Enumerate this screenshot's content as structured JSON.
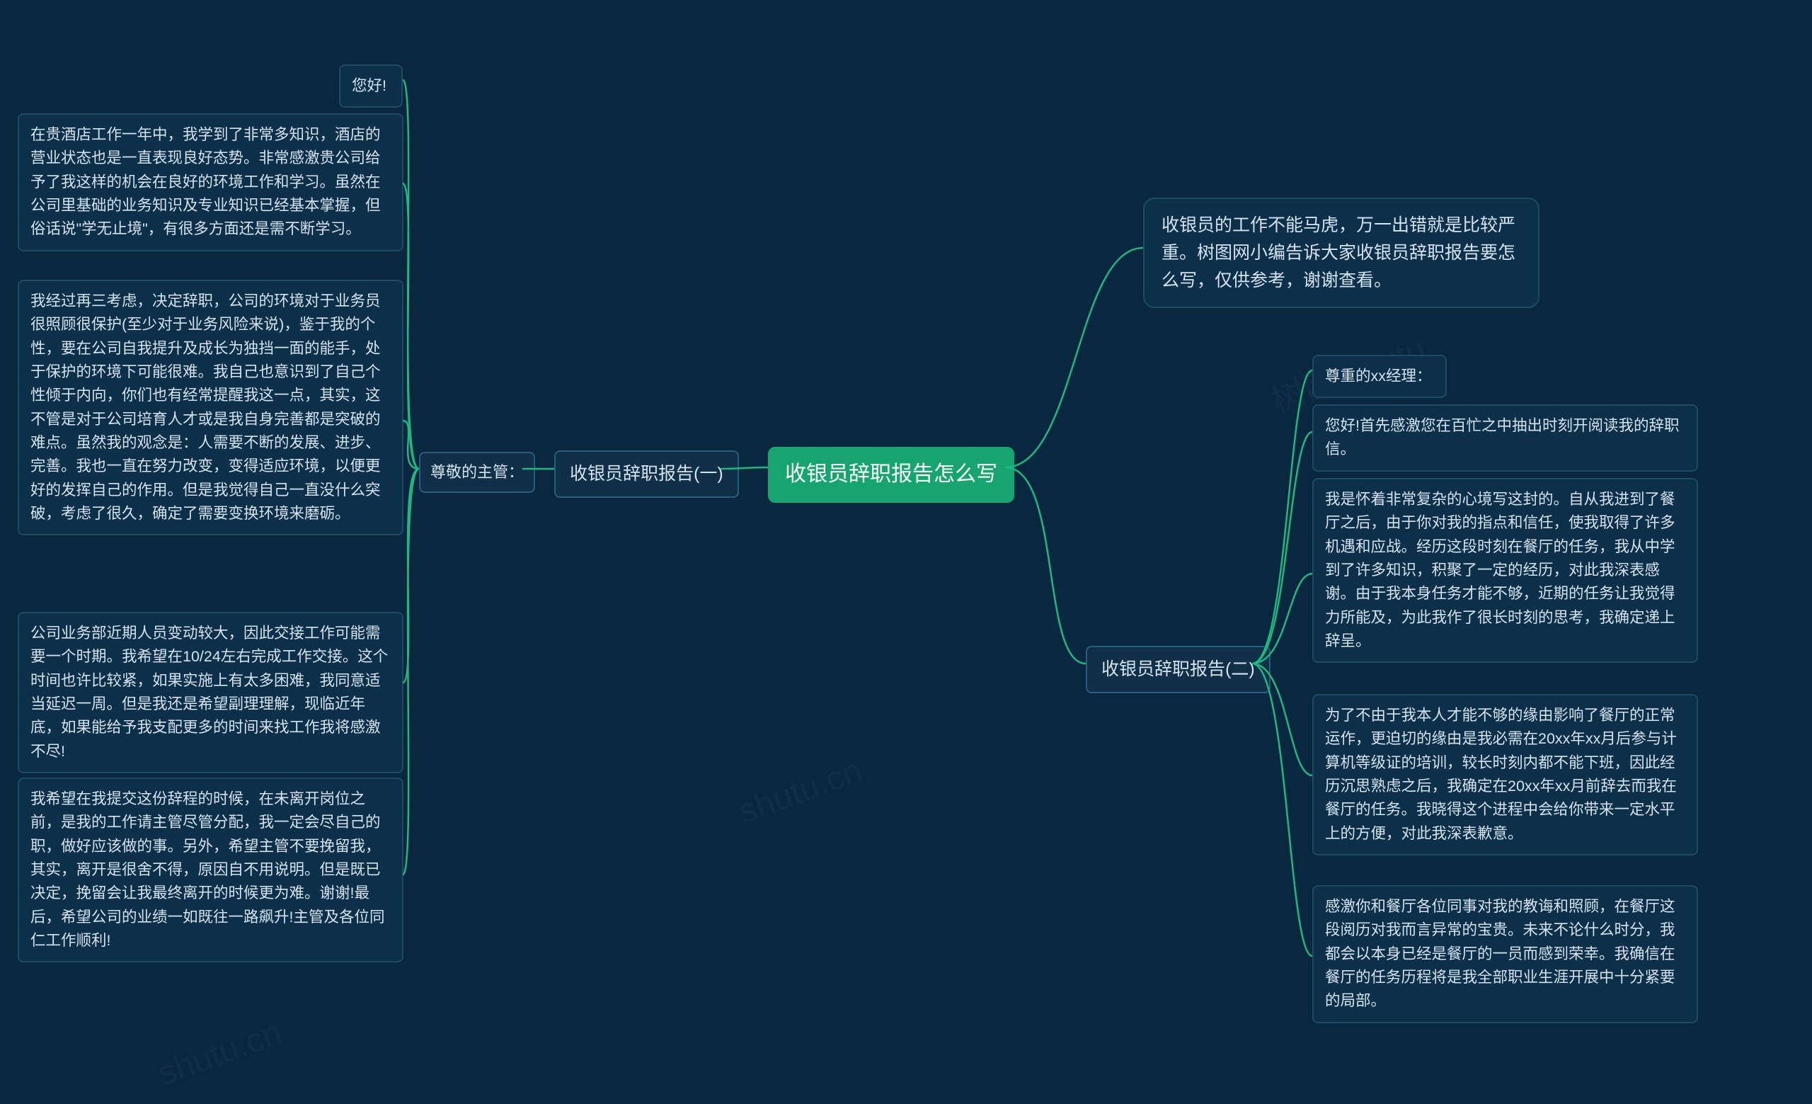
{
  "watermarks": [
    "shutu.cn",
    "shutu.cn",
    "树图 shutu",
    "shutu.cn",
    "shutu.cn"
  ],
  "root": {
    "title": "收银员辞职报告怎么写"
  },
  "intro": {
    "text": "收银员的工作不能马虎，万一出错就是比较严重。树图网小编告诉大家收银员辞职报告要怎么写，仅供参考，谢谢查看。"
  },
  "report1": {
    "title": "收银员辞职报告(一)",
    "salutation": "尊敬的主管：",
    "p1": "您好!",
    "p2": "在贵酒店工作一年中，我学到了非常多知识，酒店的营业状态也是一直表现良好态势。非常感激贵公司给予了我这样的机会在良好的环境工作和学习。虽然在公司里基础的业务知识及专业知识已经基本掌握，但俗话说\"学无止境\"，有很多方面还是需不断学习。",
    "p3": "我经过再三考虑，决定辞职，公司的环境对于业务员很照顾很保护(至少对于业务风险来说)，鉴于我的个性，要在公司自我提升及成长为独挡一面的能手，处于保护的环境下可能很难。我自己也意识到了自己个性倾于内向，你们也有经常提醒我这一点，其实，这不管是对于公司培育人才或是我自身完善都是突破的难点。虽然我的观念是：人需要不断的发展、进步、完善。我也一直在努力改变，变得适应环境，以便更好的发挥自己的作用。但是我觉得自己一直没什么突破，考虑了很久，确定了需要变换环境来磨砺。",
    "p4": "公司业务部近期人员变动较大，因此交接工作可能需要一个时期。我希望在10/24左右完成工作交接。这个时间也许比较紧，如果实施上有太多困难，我同意适当延迟一周。但是我还是希望副理理解，现临近年底，如果能给予我支配更多的时间来找工作我将感激不尽!",
    "p5": "我希望在我提交这份辞程的时候，在未离开岗位之前，是我的工作请主管尽管分配，我一定会尽自己的职，做好应该做的事。另外，希望主管不要挽留我，其实，离开是很舍不得，原因自不用说明。但是既已决定，挽留会让我最终离开的时候更为难。谢谢!最后，希望公司的业绩一如既往一路飙升!主管及各位同仁工作顺利!"
  },
  "report2": {
    "title": "收银员辞职报告(二)",
    "p1": "尊重的xx经理：",
    "p2": "您好!首先感激您在百忙之中抽出时刻开阅读我的辞职信。",
    "p3": "我是怀着非常复杂的心境写这封的。自从我进到了餐厅之后，由于你对我的指点和信任，使我取得了许多机遇和应战。经历这段时刻在餐厅的任务，我从中学到了许多知识，积聚了一定的经历，对此我深表感谢。由于我本身任务才能不够，近期的任务让我觉得力所能及，为此我作了很长时刻的思考，我确定递上辞呈。",
    "p4": "为了不由于我本人才能不够的缘由影响了餐厅的正常运作，更迫切的缘由是我必需在20xx年xx月后参与计算机等级证的培训，较长时刻内都不能下班，因此经历沉思熟虑之后，我确定在20xx年xx月前辞去而我在餐厅的任务。我晓得这个进程中会给你带来一定水平上的方便，对此我深表歉意。",
    "p5": "感激你和餐厅各位同事对我的教诲和照顾，在餐厅这段阅历对我而言异常的宝贵。未来不论什么时分，我都会以本身已经是餐厅的一员而感到荣幸。我确信在餐厅的任务历程将是我全部职业生涯开展中十分紧要的局部。"
  }
}
